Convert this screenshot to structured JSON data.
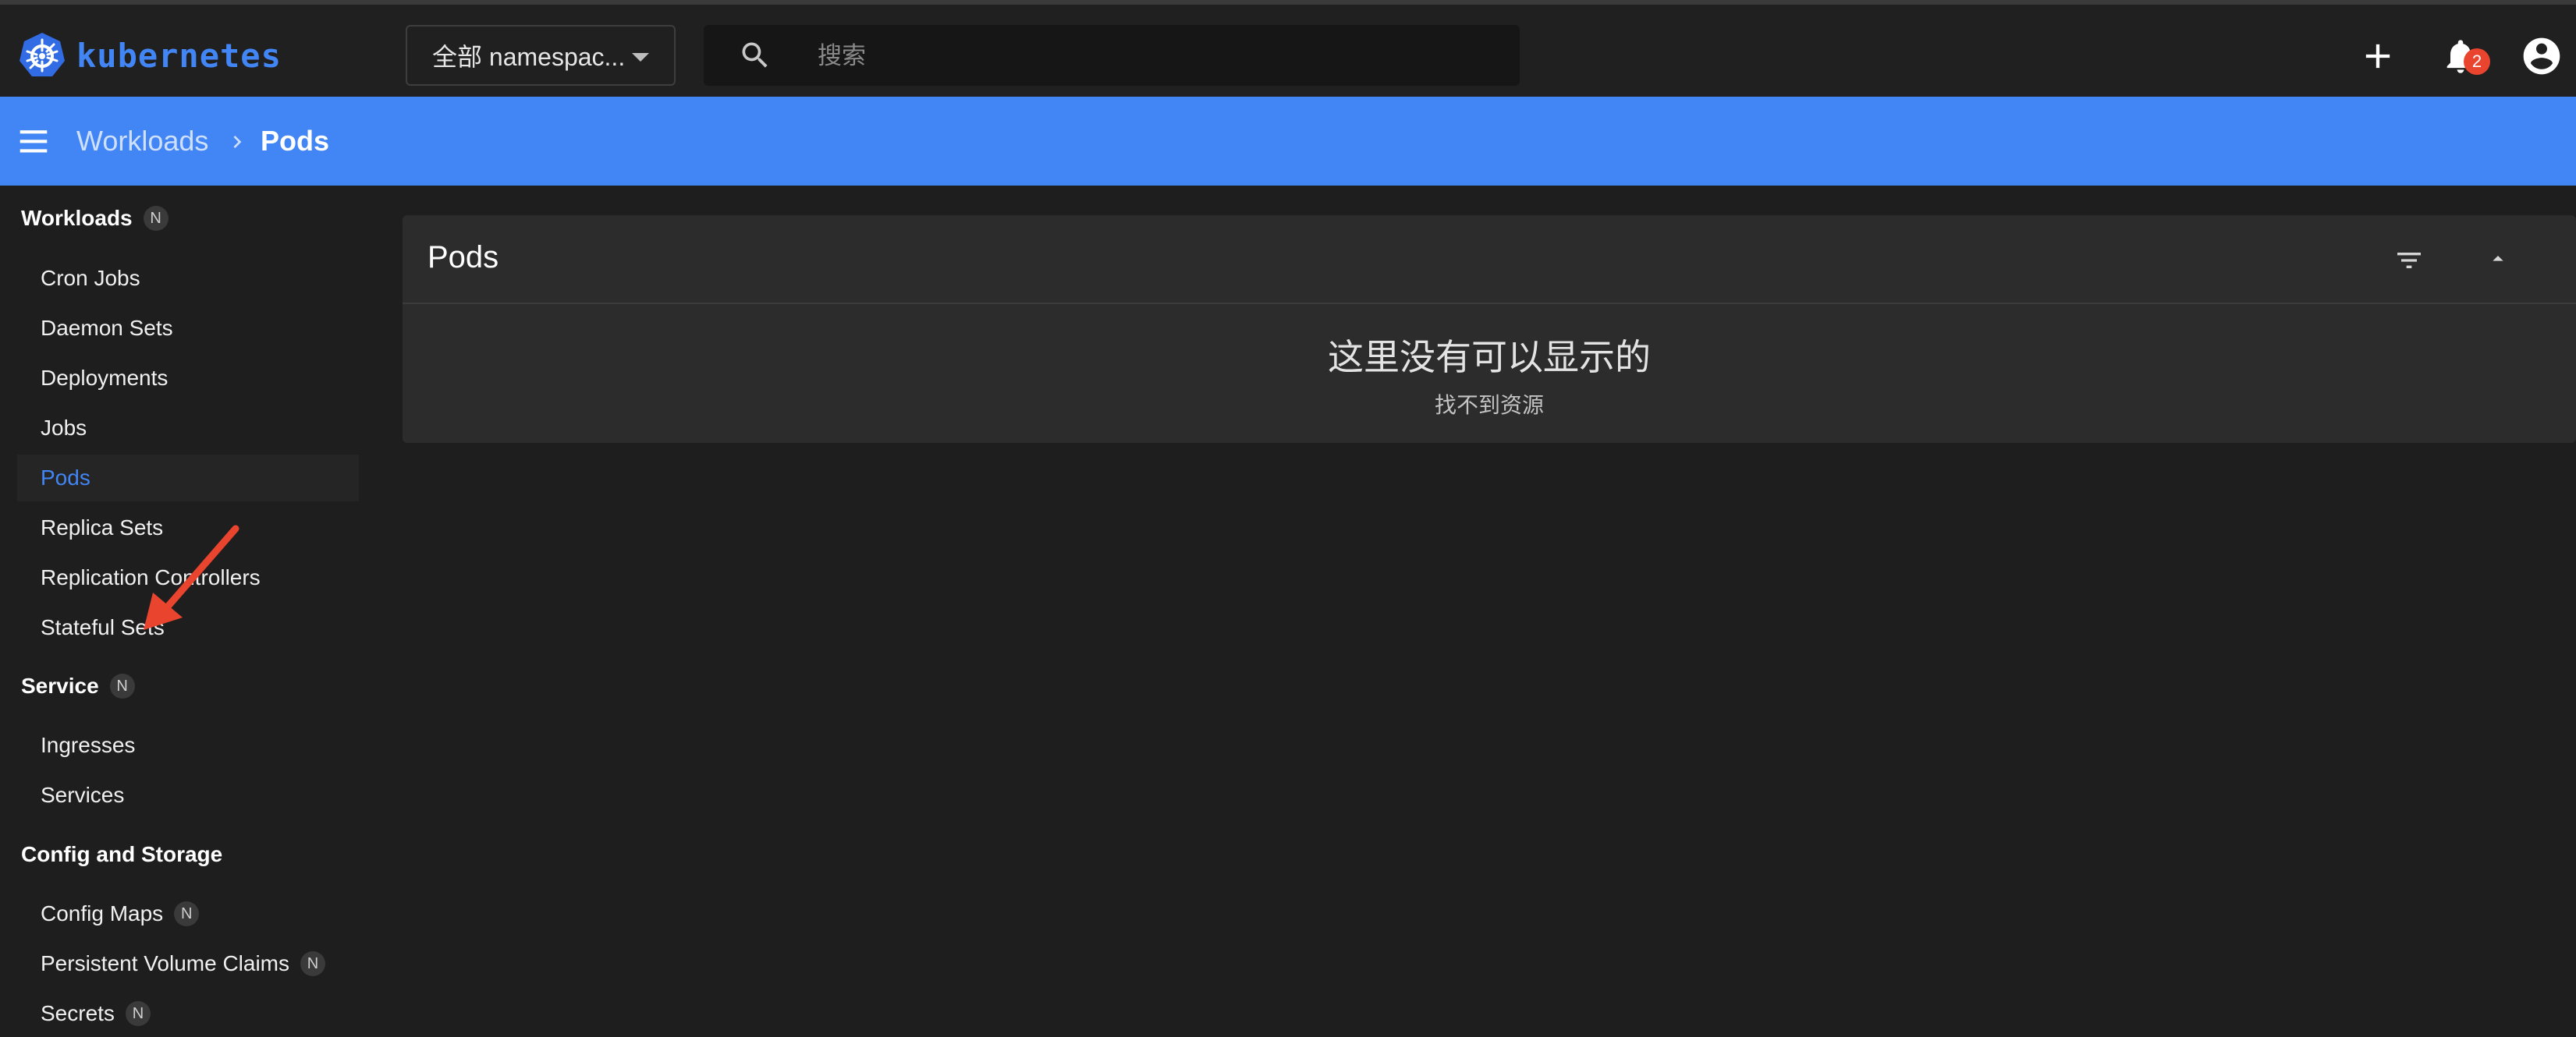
{
  "app": {
    "logo_text": "kubernetes",
    "brand_color": "#4285f4"
  },
  "topbar": {
    "namespace_select": "全部 namespac...",
    "search_placeholder": "搜索",
    "search_value": "",
    "notifications_count": "2",
    "icons": [
      "search-icon",
      "plus-icon",
      "bell-icon",
      "account-icon"
    ]
  },
  "breadcrumb": {
    "items": [
      "Workloads",
      "Pods"
    ]
  },
  "sidebar": {
    "sections": [
      {
        "title": "Workloads",
        "chip": "N",
        "items": [
          {
            "label": "Cron Jobs"
          },
          {
            "label": "Daemon Sets"
          },
          {
            "label": "Deployments"
          },
          {
            "label": "Jobs"
          },
          {
            "label": "Pods",
            "active": true
          },
          {
            "label": "Replica Sets"
          },
          {
            "label": "Replication Controllers"
          },
          {
            "label": "Stateful Sets"
          }
        ]
      },
      {
        "title": "Service",
        "chip": "N",
        "items": [
          {
            "label": "Ingresses"
          },
          {
            "label": "Services"
          }
        ]
      },
      {
        "title": "Config and Storage",
        "items": [
          {
            "label": "Config Maps",
            "chip": "N"
          },
          {
            "label": "Persistent Volume Claims",
            "chip": "N"
          },
          {
            "label": "Secrets",
            "chip": "N"
          }
        ]
      }
    ]
  },
  "card": {
    "title": "Pods",
    "empty_title": "这里没有可以显示的",
    "empty_subtitle": "找不到资源"
  },
  "colors": {
    "accent": "#4285f4",
    "badge": "#e8442e",
    "annotation_arrow": "#e8442e"
  }
}
